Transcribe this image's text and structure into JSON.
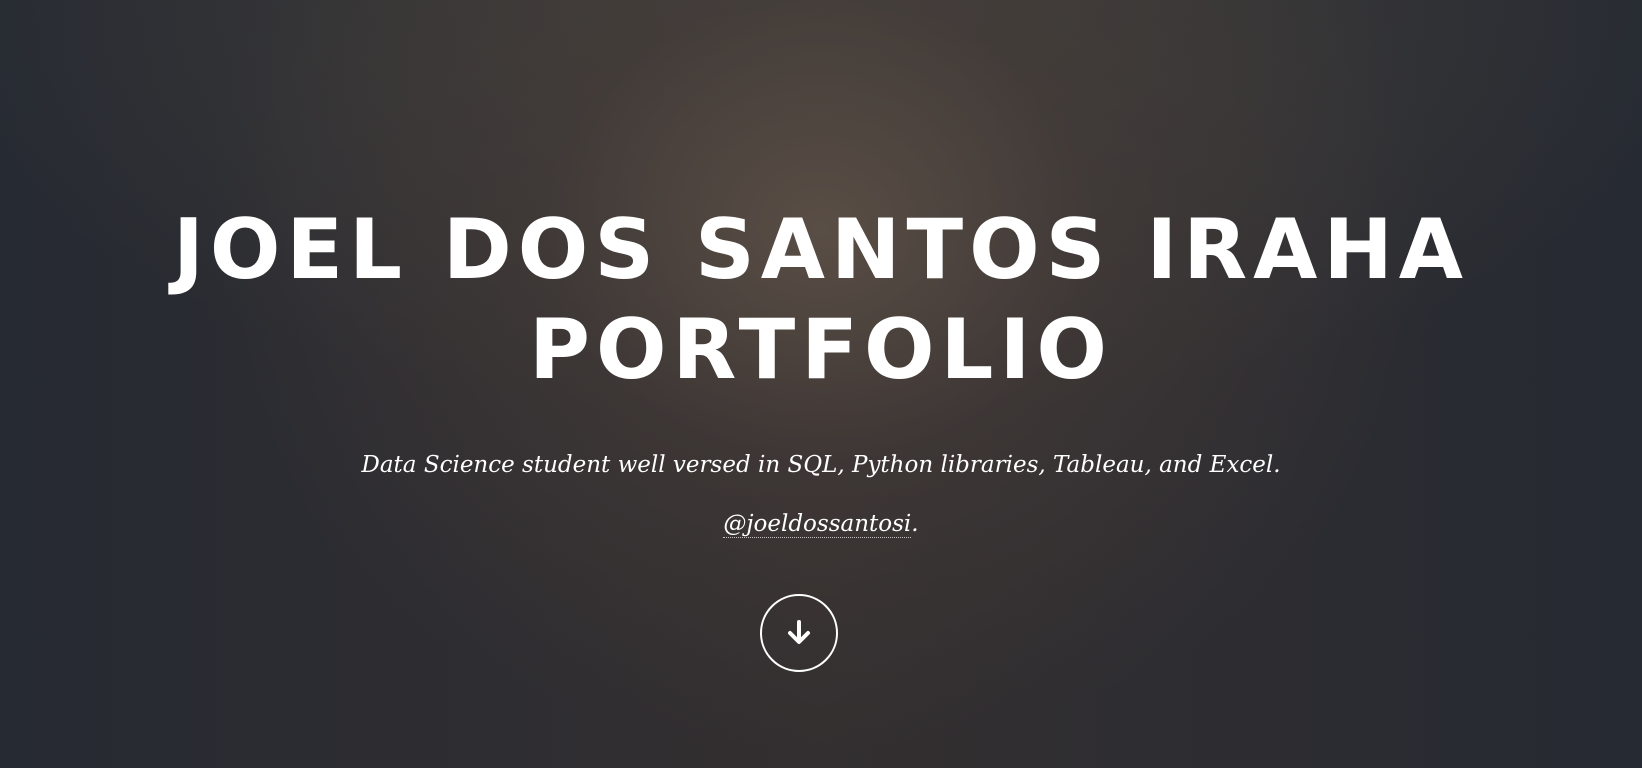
{
  "banner": {
    "title_line_1": "JOEL DOS SANTOS IRAHA",
    "title_line_2": "PORTFOLIO",
    "description": "Data Science student well versed in SQL, Python libraries, Tableau, and Excel.",
    "handle": "@joeldossantosi",
    "handle_suffix": "."
  },
  "scroll_button": {
    "icon": "arrow-down-icon"
  },
  "colors": {
    "text": "#ffffff",
    "background_edge": "#262a32",
    "background_center": "#4a3f3a"
  }
}
